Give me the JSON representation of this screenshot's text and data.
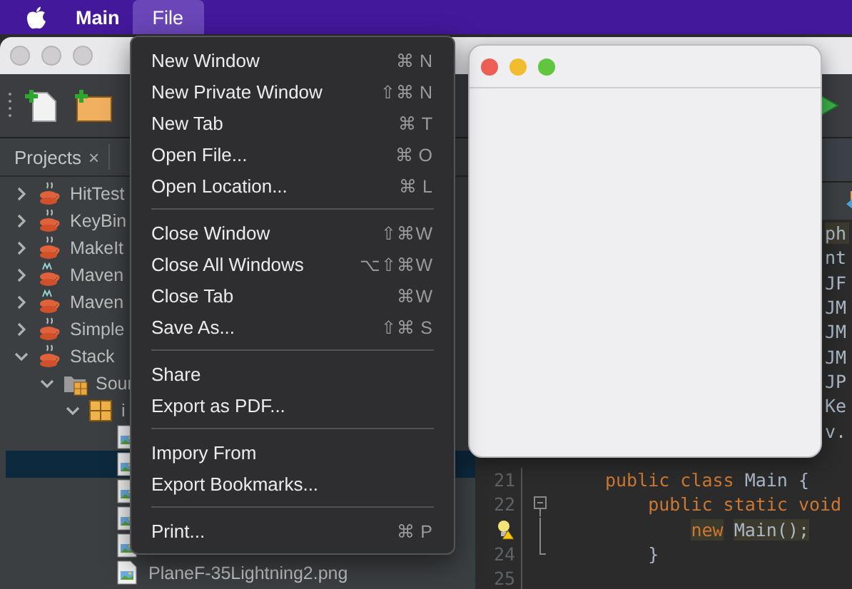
{
  "menubar": {
    "items": [
      {
        "label": "Main",
        "selected": false
      },
      {
        "label": "File",
        "selected": true
      }
    ]
  },
  "file_menu": {
    "groups": [
      [
        {
          "label": "New Window",
          "shortcut": "⌘ N"
        },
        {
          "label": "New Private Window",
          "shortcut": "⇧⌘ N"
        },
        {
          "label": "New Tab",
          "shortcut": "⌘ T"
        },
        {
          "label": "Open File...",
          "shortcut": "⌘ O"
        },
        {
          "label": "Open Location...",
          "shortcut": "⌘ L"
        }
      ],
      [
        {
          "label": "Close Window",
          "shortcut": "⇧⌘W"
        },
        {
          "label": "Close All Windows",
          "shortcut": "⌥⇧⌘W"
        },
        {
          "label": "Close Tab",
          "shortcut": "⌘W"
        },
        {
          "label": "Save As...",
          "shortcut": "⇧⌘ S"
        }
      ],
      [
        {
          "label": "Share"
        },
        {
          "label": "Export as PDF..."
        }
      ],
      [
        {
          "label": "Impory From"
        },
        {
          "label": "Export Bookmarks..."
        }
      ],
      [
        {
          "label": "Print...",
          "shortcut": "⌘ P"
        }
      ]
    ]
  },
  "ide_window": {
    "projects_tab": {
      "label": "Projects",
      "close": "×"
    },
    "tree": [
      {
        "label": "HitTest",
        "kind": "project",
        "expanded": false
      },
      {
        "label": "KeyBin",
        "kind": "project",
        "expanded": false
      },
      {
        "label": "MakeIt",
        "kind": "project",
        "expanded": false
      },
      {
        "label": "Maven",
        "kind": "maven_project",
        "expanded": false
      },
      {
        "label": "Maven",
        "kind": "maven_project",
        "expanded": false
      },
      {
        "label": "Simple",
        "kind": "project",
        "expanded": false
      },
      {
        "label": "Stack",
        "kind": "project",
        "expanded": true,
        "children": [
          {
            "label": "Sour",
            "kind": "source_folder",
            "expanded": true,
            "children": [
              {
                "label": "i",
                "kind": "package",
                "expanded": true,
                "children": [
                  {
                    "kind": "image",
                    "selected": false
                  },
                  {
                    "kind": "image",
                    "selected": true
                  },
                  {
                    "kind": "image",
                    "selected": false
                  },
                  {
                    "kind": "image",
                    "selected": false
                  },
                  {
                    "kind": "image",
                    "selected": false
                  },
                  {
                    "kind": "image",
                    "label": "PlaneF-35Lightning2.png",
                    "selected": false
                  }
                ]
              }
            ]
          }
        ]
      }
    ],
    "editor": {
      "clipped_lines": [
        {
          "text": "ph",
          "highlighted": true
        },
        {
          "text": "nt",
          "highlighted": false
        },
        {
          "text": "JF",
          "highlighted": false
        },
        {
          "text": "JM",
          "highlighted": false
        },
        {
          "text": "JM",
          "highlighted": false
        },
        {
          "text": "JM",
          "highlighted": false
        },
        {
          "text": "JP",
          "highlighted": false
        },
        {
          "text": "Ke",
          "highlighted": false
        },
        {
          "text": "v.",
          "highlighted": false
        }
      ],
      "lines": [
        {
          "number": "21",
          "hint": false,
          "fold_start": false,
          "fold_continues": false,
          "fold_end": false,
          "tokens": [
            {
              "text": "public class",
              "kind": "keyword",
              "highlighted": false
            },
            {
              "text": " Main {",
              "kind": "plain",
              "highlighted": false
            }
          ]
        },
        {
          "number": "22",
          "hint": false,
          "fold_start": true,
          "fold_continues": false,
          "fold_end": false,
          "tokens": [
            {
              "text": "    public static void",
              "kind": "keyword",
              "highlighted": false
            }
          ]
        },
        {
          "hint": true,
          "fold_start": false,
          "fold_continues": true,
          "fold_end": false,
          "tokens": [
            {
              "text": "        new",
              "kind": "keyword",
              "highlighted": true
            },
            {
              "text": " Main();",
              "kind": "plain",
              "highlighted": true
            }
          ]
        },
        {
          "number": "24",
          "hint": false,
          "fold_start": false,
          "fold_continues": false,
          "fold_end": true,
          "tokens": [
            {
              "text": "    }",
              "kind": "plain",
              "highlighted": false
            }
          ]
        },
        {
          "number": "25",
          "hint": false,
          "fold_start": false,
          "fold_continues": false,
          "fold_end": false
        }
      ]
    }
  }
}
